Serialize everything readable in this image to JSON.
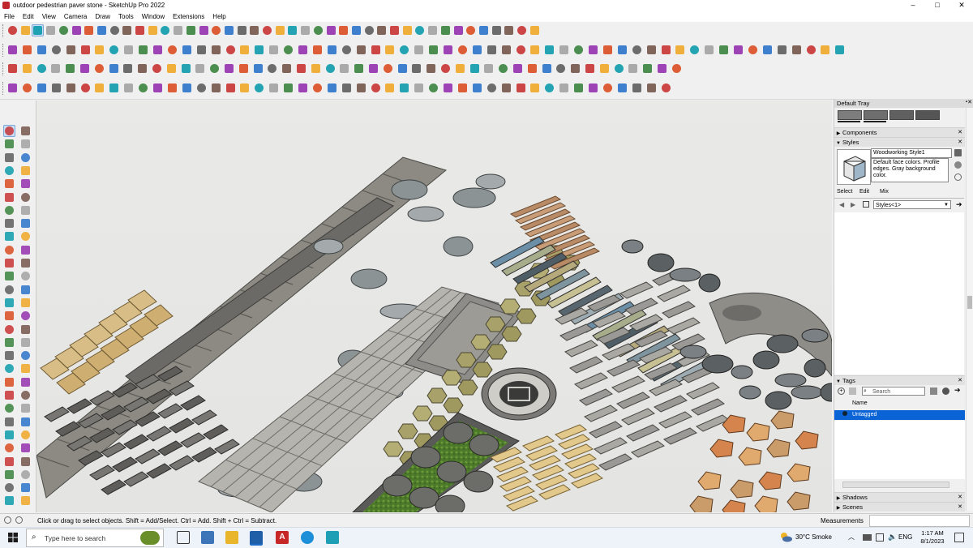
{
  "window": {
    "title": "outdoor pedestrian paver stone - SketchUp Pro 2022",
    "minimize": "–",
    "maximize": "□",
    "close": "✕"
  },
  "menu": [
    "File",
    "Edit",
    "View",
    "Camera",
    "Draw",
    "Tools",
    "Window",
    "Extensions",
    "Help"
  ],
  "tray": {
    "title": "Default Tray",
    "components_label": "Components",
    "styles_label": "Styles",
    "style_name": "Woodworking Style1",
    "style_description": "Default face colors. Profile edges. Gray background color.",
    "style_tabs": [
      "Select",
      "Edit",
      "Mix"
    ],
    "styles_dropdown": "Styles<1>",
    "tags_label": "Tags",
    "tags_search_placeholder": "Search",
    "tags_column": "Name",
    "tag_item": "Untagged",
    "shadows_label": "Shadows",
    "scenes_label": "Scenes"
  },
  "status": {
    "message": "Click or drag to select objects. Shift = Add/Select. Ctrl = Add. Shift + Ctrl = Subtract.",
    "measurements_label": "Measurements"
  },
  "taskbar": {
    "search_placeholder": "Type here to search",
    "weather": "30°C  Smoke",
    "language": "ENG",
    "time": "1:17 AM",
    "date": "8/1/2023"
  },
  "colors": {
    "selected_tag": "#0a64d6",
    "accent_red": "#c62828",
    "accent_blue": "#1e6bc8"
  }
}
